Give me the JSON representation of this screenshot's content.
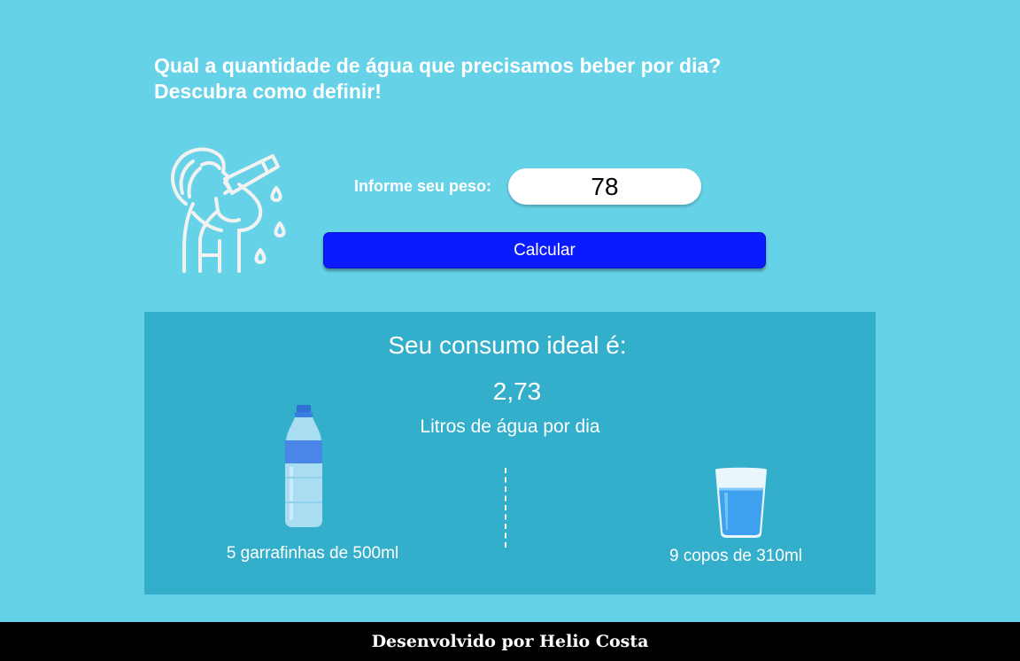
{
  "header": {
    "line1": "Qual a quantidade de água que precisamos beber por dia?",
    "line2": "Descubra como definir!"
  },
  "form": {
    "weight_label": "Informe seu peso:",
    "weight_value": "78",
    "calc_label": "Calcular"
  },
  "result": {
    "title": "Seu consumo ideal é:",
    "liters": "2,73",
    "unit": "Litros de água por dia",
    "bottles_text": "5 garrafinhas de 500ml",
    "glasses_text": "9 copos de 310ml"
  },
  "icons": {
    "person": "person-drinking-icon",
    "bottle": "water-bottle-icon",
    "glass": "water-glass-icon"
  },
  "colors": {
    "background": "#66d2e8",
    "panel": "#33aecb",
    "button": "#0a1cff",
    "footer": "#000000"
  },
  "footer": {
    "credit": "Desenvolvido por Helio Costa"
  }
}
